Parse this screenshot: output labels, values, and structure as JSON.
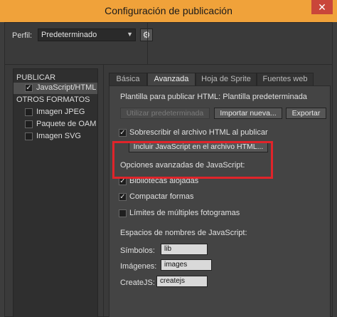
{
  "window": {
    "title": "Configuración de publicación",
    "close_glyph": "✕"
  },
  "profile": {
    "label": "Perfil:",
    "value": "Predeterminado",
    "arrow": "▼",
    "gear_glyph": "⚙"
  },
  "left": {
    "cat_publish": "PUBLICAR",
    "js_html": "JavaScript/HTML",
    "cat_other": "OTROS FORMATOS",
    "formats": [
      "Imagen JPEG",
      "Paquete de OAM",
      "Imagen SVG"
    ]
  },
  "tabs": [
    "Básica",
    "Avanzada",
    "Hoja de Sprite",
    "Fuentes web"
  ],
  "template": {
    "label": "Plantilla para publicar HTML:",
    "value": "Plantilla predeterminada",
    "use_default": "Utilizar predeterminada",
    "import": "Importar nueva...",
    "export": "Exportar"
  },
  "overwrite": {
    "label": "Sobrescribir el archivo HTML al publicar",
    "include_js": "Incluir JavaScript en el archivo HTML..."
  },
  "js_options": {
    "title": "Opciones avanzadas de JavaScript:",
    "hosted": "Bibliotecas alojadas",
    "compact": "Compactar formas",
    "multiframe": "Límites de múltiples fotogramas"
  },
  "namespaces": {
    "title": "Espacios de nombres de JavaScript:",
    "symbols_label": "Símbolos:",
    "symbols_value": "lib",
    "images_label": "Imágenes:",
    "images_value": "images",
    "createjs_label": "CreateJS:",
    "createjs_value": "createjs"
  },
  "check_glyph": "✓",
  "colors": {
    "title_bar": "#f0a23a",
    "highlight": "#e0242a"
  }
}
